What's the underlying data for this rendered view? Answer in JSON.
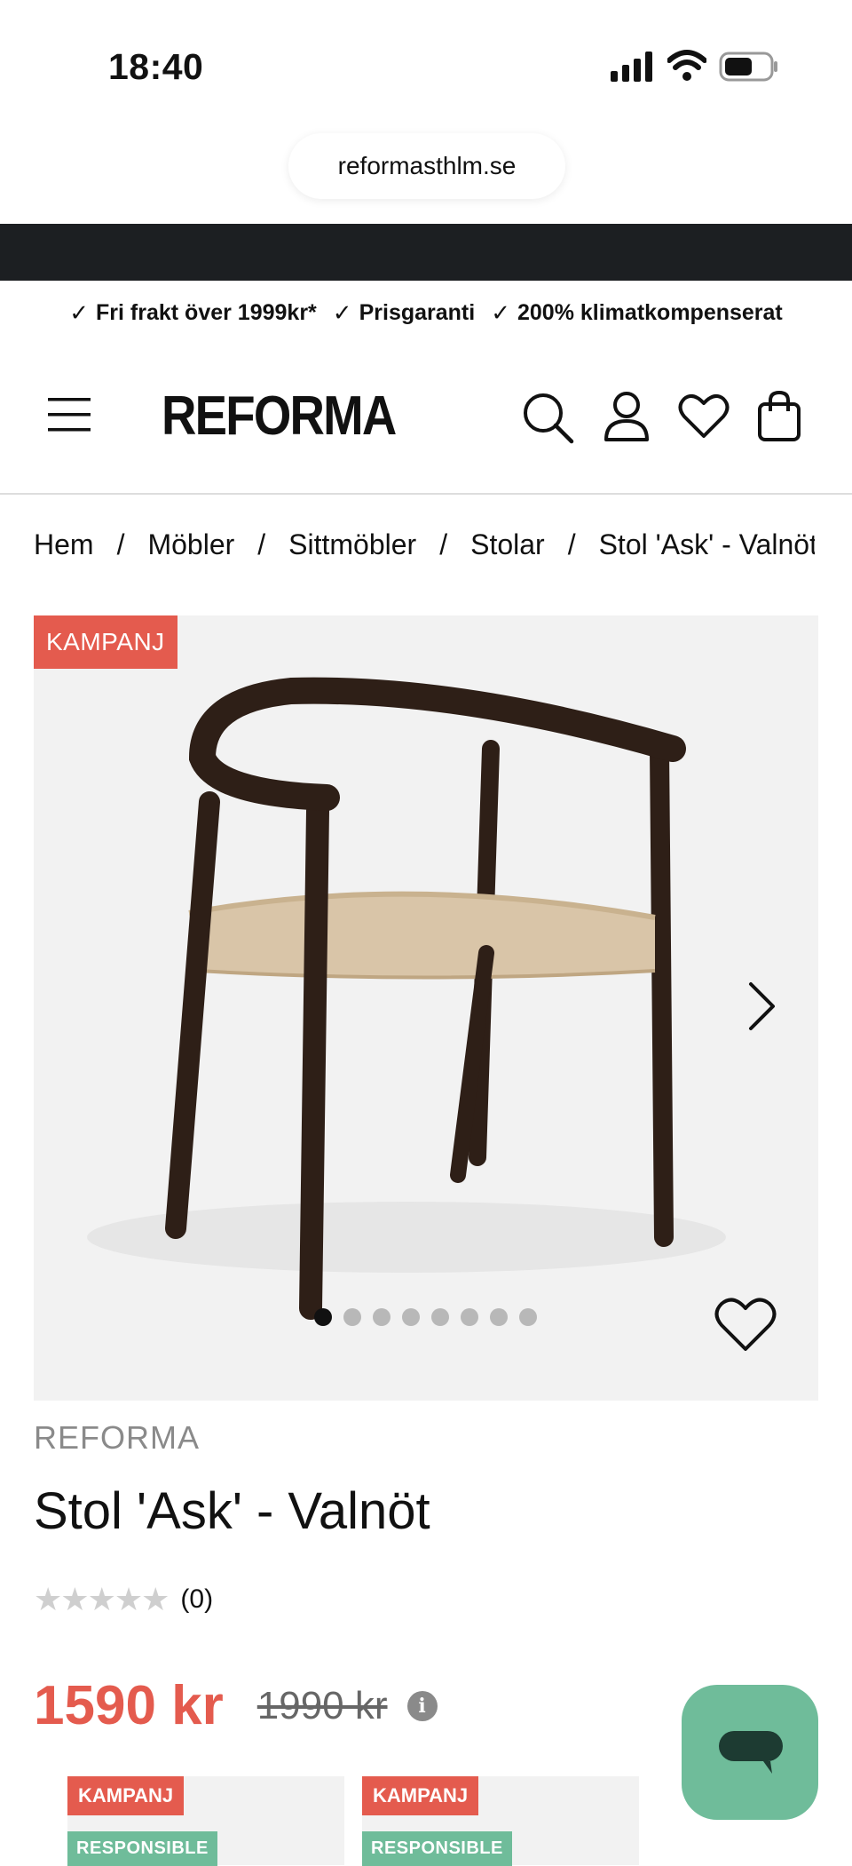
{
  "status_bar": {
    "time": "18:40"
  },
  "browser": {
    "url": "reformasthlm.se"
  },
  "usp": [
    {
      "label": "Fri frakt över 1999kr*"
    },
    {
      "label": "Prisgaranti"
    },
    {
      "label": "200% klimatkompenserat"
    }
  ],
  "header": {
    "logo": "REFORMA"
  },
  "breadcrumb": [
    "Hem",
    "Möbler",
    "Sittmöbler",
    "Stolar",
    "Stol 'Ask' - Valnöt"
  ],
  "product": {
    "badge": "KAMPANJ",
    "brand": "REFORMA",
    "title": "Stol 'Ask' - Valnöt",
    "rating_count": "(0)",
    "rating": 0,
    "price": "1590 kr",
    "old_price": "1990 kr",
    "image_count": 8,
    "active_image": 1
  },
  "related": [
    {
      "badge": "KAMPANJ",
      "tag": "RESPONSIBLE"
    },
    {
      "badge": "KAMPANJ",
      "tag": "RESPONSIBLE"
    }
  ],
  "colors": {
    "accent": "#e45b4e",
    "chat": "#6fbc9a",
    "dark_bar": "#1c1f22"
  },
  "icons": [
    "signal-icon",
    "wifi-icon",
    "battery-icon",
    "menu-icon",
    "search-icon",
    "account-icon",
    "heart-icon",
    "bag-icon",
    "chevron-right-icon",
    "chat-icon",
    "info-icon"
  ]
}
